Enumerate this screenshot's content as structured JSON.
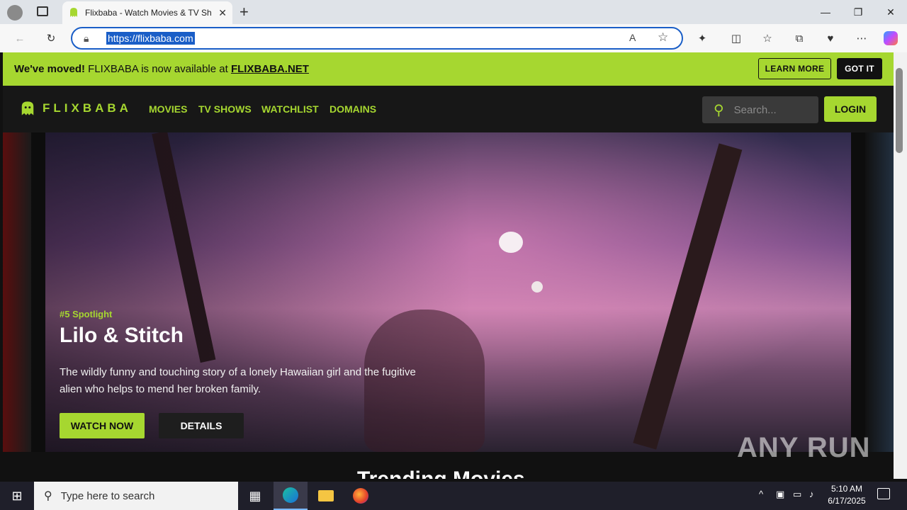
{
  "browser": {
    "tab_title": "Flixbaba - Watch Movies & TV Sh",
    "url": "https://flixbaba.com",
    "icons": [
      "profile-icon",
      "tab-actions-icon",
      "close-tab-icon",
      "new-tab-icon",
      "minimize-icon",
      "restore-icon",
      "close-window-icon",
      "back-icon",
      "refresh-icon",
      "lock-icon",
      "read-aloud-icon",
      "favorite-star-icon",
      "extensions-icon",
      "split-screen-icon",
      "favorites-icon",
      "collections-icon",
      "browser-essentials-icon",
      "more-icon",
      "copilot-icon"
    ]
  },
  "notice": {
    "lead": "We've moved!",
    "text": " FLIXBABA is now available at ",
    "link": "FLIXBABA.NET",
    "learn_more": "LEARN MORE",
    "got_it": "GOT IT"
  },
  "header": {
    "logo": "FLIXBABA",
    "nav": [
      "MOVIES",
      "TV SHOWS",
      "WATCHLIST",
      "DOMAINS"
    ],
    "search_placeholder": "Search...",
    "login": "LOGIN"
  },
  "hero": {
    "spotlight": "#5 Spotlight",
    "title": "Lilo & Stitch",
    "description": "The wildly funny and touching story of a lonely Hawaiian girl and the fugitive alien who helps to mend her broken family.",
    "watch_now": "WATCH NOW",
    "details": "DETAILS"
  },
  "section": {
    "title": "Trending Movies"
  },
  "watermark": "ANY RUN",
  "taskbar": {
    "search_placeholder": "Type here to search",
    "time": "5:10 AM",
    "date": "6/17/2025"
  },
  "colors": {
    "accent": "#a6d730",
    "dark": "#171717",
    "address_border": "#1a5ec7"
  }
}
